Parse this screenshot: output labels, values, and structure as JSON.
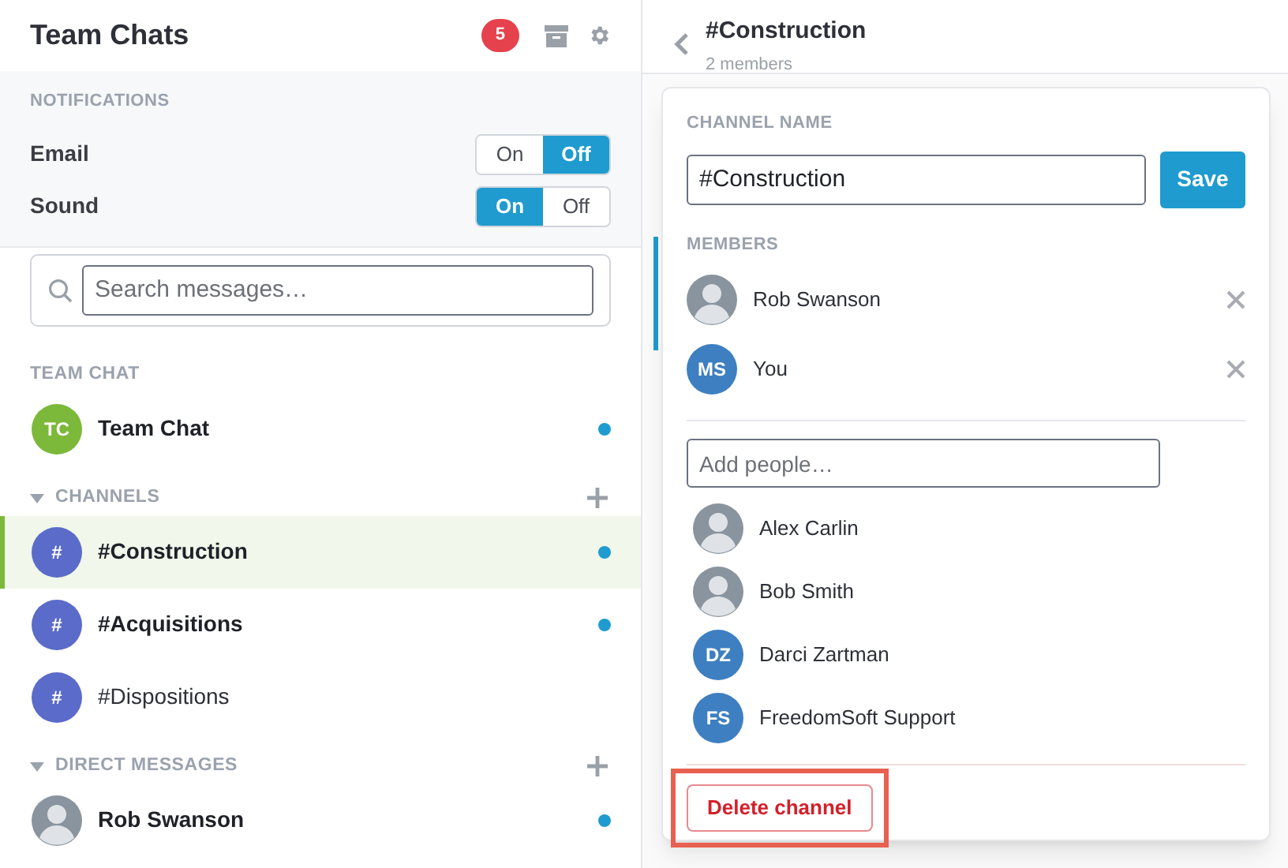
{
  "sidebar": {
    "title": "Team Chats",
    "badge": "5",
    "notifications": {
      "heading": "NOTIFICATIONS",
      "settings": [
        {
          "label": "Email",
          "options": [
            {
              "label": "On",
              "selected": false
            },
            {
              "label": "Off",
              "selected": true
            }
          ]
        },
        {
          "label": "Sound",
          "options": [
            {
              "label": "On",
              "selected": true
            },
            {
              "label": "Off",
              "selected": false
            }
          ]
        }
      ]
    },
    "search": {
      "placeholder": "Search messages…"
    },
    "sections": [
      {
        "heading": "TEAM CHAT",
        "collapsible": false,
        "items": [
          {
            "name": "Team Chat",
            "avatar": {
              "kind": "initials",
              "text": "TC",
              "color": "#7cb93a"
            },
            "unread": true,
            "selected": false
          }
        ]
      },
      {
        "heading": "CHANNELS",
        "collapsible": true,
        "items": [
          {
            "name": "#Construction",
            "avatar": {
              "kind": "initials",
              "text": "#",
              "color": "#5b6bc9"
            },
            "unread": true,
            "selected": true
          },
          {
            "name": "#Acquisitions",
            "avatar": {
              "kind": "initials",
              "text": "#",
              "color": "#5b6bc9"
            },
            "unread": true,
            "selected": false
          },
          {
            "name": "#Dispositions",
            "avatar": {
              "kind": "initials",
              "text": "#",
              "color": "#5b6bc9"
            },
            "unread": false,
            "selected": false
          }
        ]
      },
      {
        "heading": "DIRECT MESSAGES",
        "collapsible": true,
        "items": [
          {
            "name": "Rob Swanson",
            "avatar": {
              "kind": "photo"
            },
            "unread": true,
            "selected": false
          }
        ]
      }
    ]
  },
  "conversation": {
    "title": "#Construction",
    "subtitle": "2 members"
  },
  "channel_settings": {
    "name_label": "CHANNEL NAME",
    "name_value": "#Construction",
    "save": "Save",
    "members_label": "MEMBERS",
    "members": [
      {
        "name": "Rob Swanson",
        "avatar": {
          "kind": "photo"
        }
      },
      {
        "name": "You",
        "avatar": {
          "kind": "initials",
          "text": "MS",
          "color": "#3d7fc1"
        }
      }
    ],
    "add_people": {
      "placeholder": "Add people…"
    },
    "suggestions": [
      {
        "name": "Alex Carlin",
        "avatar": {
          "kind": "photo"
        }
      },
      {
        "name": "Bob Smith",
        "avatar": {
          "kind": "photo"
        }
      },
      {
        "name": "Darci Zartman",
        "avatar": {
          "kind": "initials",
          "text": "DZ",
          "color": "#3d7fc1"
        }
      },
      {
        "name": "FreedomSoft Support",
        "avatar": {
          "kind": "initials",
          "text": "FS",
          "color": "#3d7fc1"
        }
      }
    ],
    "delete": "Delete channel",
    "delete_highlighted": true
  }
}
